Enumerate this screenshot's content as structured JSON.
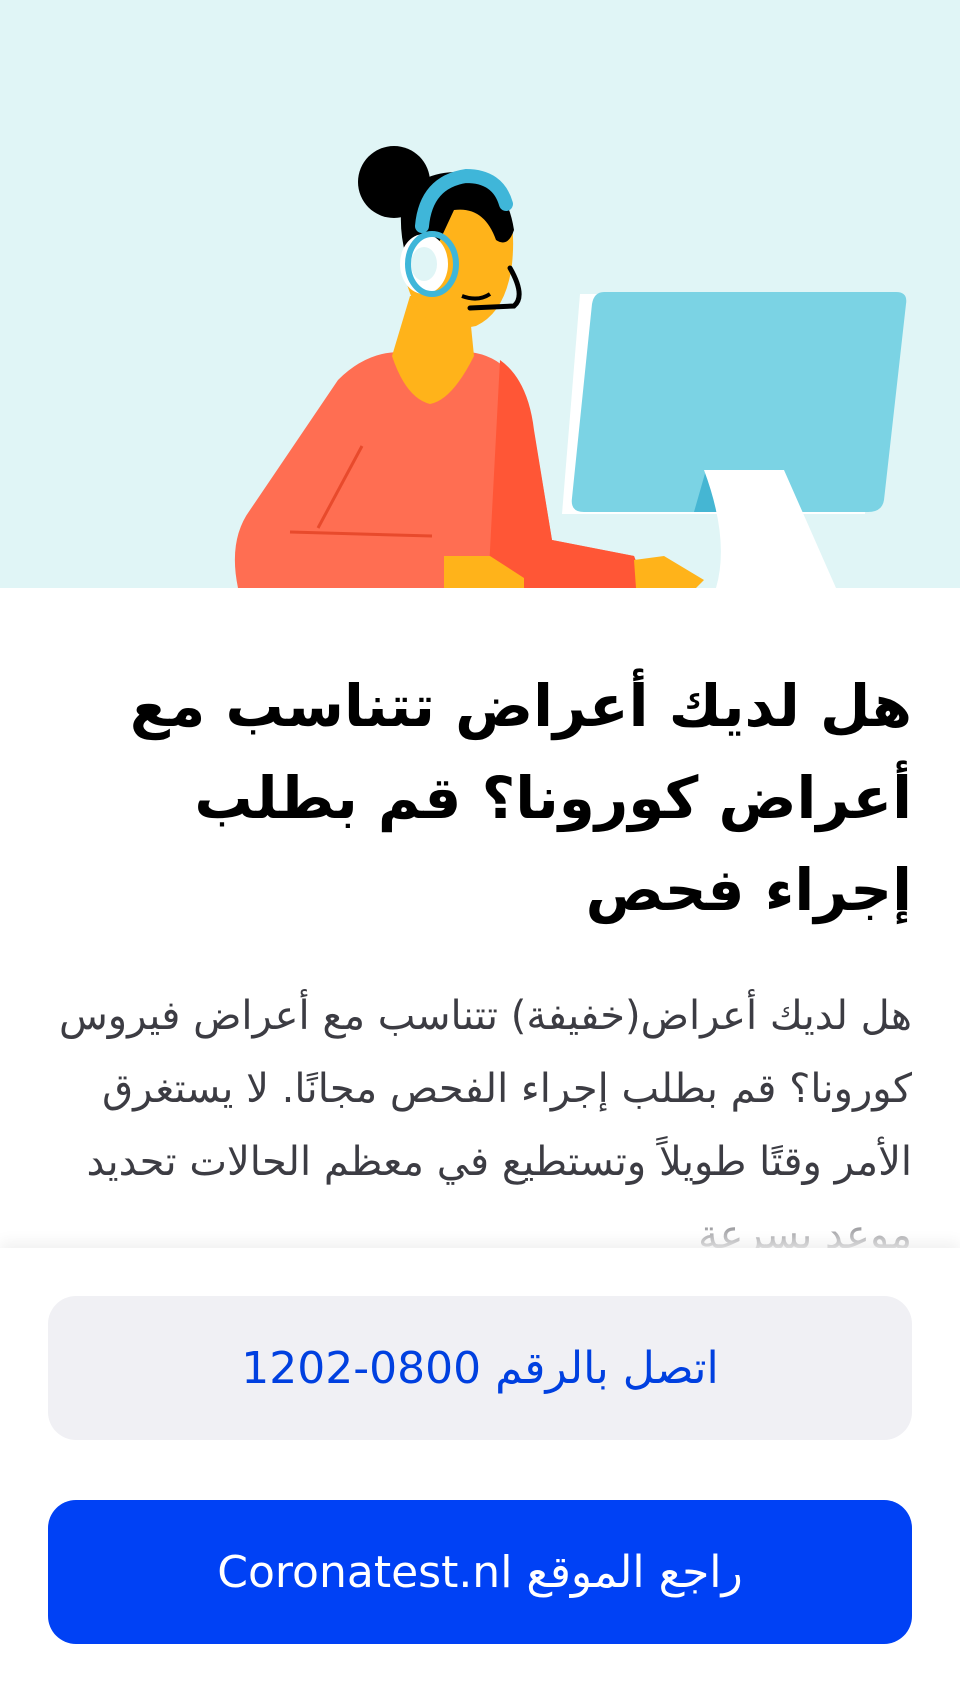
{
  "hero": {
    "illustration_icon": "call-center-agent-at-computer",
    "background_color": "#e0f5f6"
  },
  "main": {
    "title": "هل لديك أعراض تتناسب مع أعراض كورونا؟ قم بطلب إجراء فحص",
    "body": "هل لديك أعراض(خفيفة) تتناسب مع أعراض فيروس كورونا؟ قم بطلب إجراء الفحص مجانًا. لا يستغرق الأمر وقتًا طويلاً وتستطيع في معظم الحالات تحديد موعد بسرعة"
  },
  "actions": {
    "call_label": "اتصل بالرقم 0800-1202",
    "website_label": "راجع الموقع Coronatest.nl",
    "primary_color": "#0041f5",
    "secondary_text_color": "#0040e0"
  }
}
